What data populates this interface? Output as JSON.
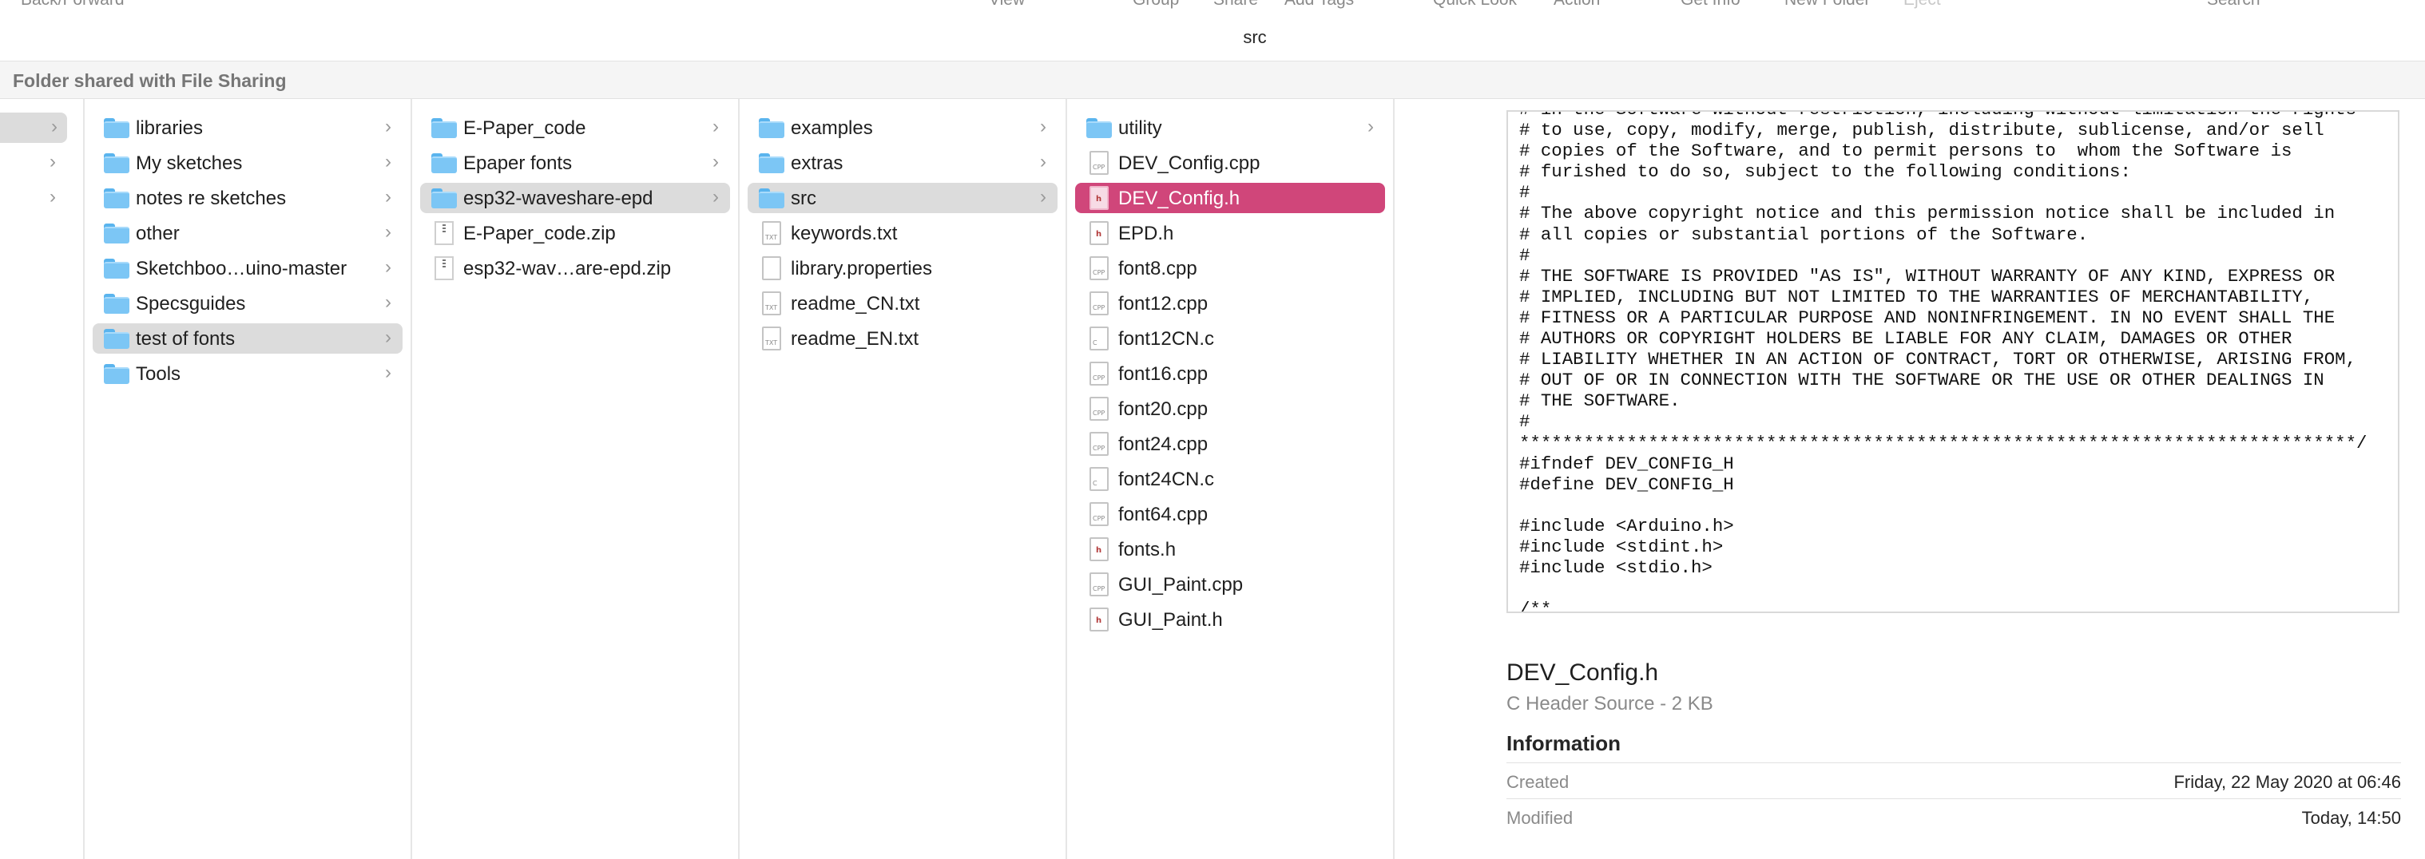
{
  "toolbar": {
    "back_forward": "Back/Forward",
    "view": "View",
    "group": "Group",
    "share": "Share",
    "add_tags": "Add Tags",
    "quick_look": "Quick Look",
    "action": "Action",
    "get_info": "Get Info",
    "new_folder": "New Folder",
    "eject": "Eject",
    "search": "Search"
  },
  "window_title": "src",
  "share_banner": "Folder shared with File Sharing",
  "column1": {
    "items": [
      {
        "name": "libraries",
        "kind": "folder"
      },
      {
        "name": "My sketches",
        "kind": "folder"
      },
      {
        "name": "notes re sketches",
        "kind": "folder"
      },
      {
        "name": "other",
        "kind": "folder"
      },
      {
        "name": "Sketchboo…uino-master",
        "kind": "folder"
      },
      {
        "name": "Specsguides",
        "kind": "folder"
      },
      {
        "name": "test of fonts",
        "kind": "folder",
        "selected": true
      },
      {
        "name": "Tools",
        "kind": "folder"
      }
    ]
  },
  "column2": {
    "items": [
      {
        "name": "E-Paper_code",
        "kind": "folder"
      },
      {
        "name": "Epaper fonts",
        "kind": "folder"
      },
      {
        "name": "esp32-waveshare-epd",
        "kind": "folder",
        "selected": true
      },
      {
        "name": "E-Paper_code.zip",
        "kind": "zip"
      },
      {
        "name": "esp32-wav…are-epd.zip",
        "kind": "zip"
      }
    ]
  },
  "column3": {
    "items": [
      {
        "name": "examples",
        "kind": "folder"
      },
      {
        "name": "extras",
        "kind": "folder"
      },
      {
        "name": "src",
        "kind": "folder",
        "selected": true
      },
      {
        "name": "keywords.txt",
        "kind": "txt"
      },
      {
        "name": "library.properties",
        "kind": "file"
      },
      {
        "name": "readme_CN.txt",
        "kind": "txt"
      },
      {
        "name": "readme_EN.txt",
        "kind": "txt"
      }
    ]
  },
  "column4": {
    "items": [
      {
        "name": "utility",
        "kind": "folder"
      },
      {
        "name": "DEV_Config.cpp",
        "kind": "cpp"
      },
      {
        "name": "DEV_Config.h",
        "kind": "h",
        "selected": true
      },
      {
        "name": "EPD.h",
        "kind": "h"
      },
      {
        "name": "font8.cpp",
        "kind": "cpp"
      },
      {
        "name": "font12.cpp",
        "kind": "cpp"
      },
      {
        "name": "font12CN.c",
        "kind": "c"
      },
      {
        "name": "font16.cpp",
        "kind": "cpp"
      },
      {
        "name": "font20.cpp",
        "kind": "cpp"
      },
      {
        "name": "font24.cpp",
        "kind": "cpp"
      },
      {
        "name": "font24CN.c",
        "kind": "c"
      },
      {
        "name": "font64.cpp",
        "kind": "cpp"
      },
      {
        "name": "fonts.h",
        "kind": "h"
      },
      {
        "name": "GUI_Paint.cpp",
        "kind": "cpp"
      },
      {
        "name": "GUI_Paint.h",
        "kind": "h"
      }
    ]
  },
  "preview": {
    "code": "# in the Software without restriction, including without limitation the rights\n# to use, copy, modify, merge, publish, distribute, sublicense, and/or sell\n# copies of the Software, and to permit persons to  whom the Software is\n# furished to do so, subject to the following conditions:\n#\n# The above copyright notice and this permission notice shall be included in\n# all copies or substantial portions of the Software.\n#\n# THE SOFTWARE IS PROVIDED \"AS IS\", WITHOUT WARRANTY OF ANY KIND, EXPRESS OR\n# IMPLIED, INCLUDING BUT NOT LIMITED TO THE WARRANTIES OF MERCHANTABILITY,\n# FITNESS OR A PARTICULAR PURPOSE AND NONINFRINGEMENT. IN NO EVENT SHALL THE\n# AUTHORS OR COPYRIGHT HOLDERS BE LIABLE FOR ANY CLAIM, DAMAGES OR OTHER\n# LIABILITY WHETHER IN AN ACTION OF CONTRACT, TORT OR OTHERWISE, ARISING FROM,\n# OUT OF OR IN CONNECTION WITH THE SOFTWARE OR THE USE OR OTHER DEALINGS IN\n# THE SOFTWARE.\n#\n******************************************************************************/\n#ifndef DEV_CONFIG_H\n#define DEV_CONFIG_H\n\n#include <Arduino.h>\n#include <stdint.h>\n#include <stdio.h>\n\n/**"
  },
  "info": {
    "file_name": "DEV_Config.h",
    "kind": "C Header Source - 2 KB",
    "heading": "Information",
    "created_label": "Created",
    "created_value": "Friday, 22 May 2020 at 06:46",
    "modified_label": "Modified",
    "modified_value": "Today, 14:50"
  },
  "colors": {
    "selection_pink": "#d0467a",
    "selection_grey": "#dcdcdc",
    "folder_blue": "#7cc6f5"
  }
}
